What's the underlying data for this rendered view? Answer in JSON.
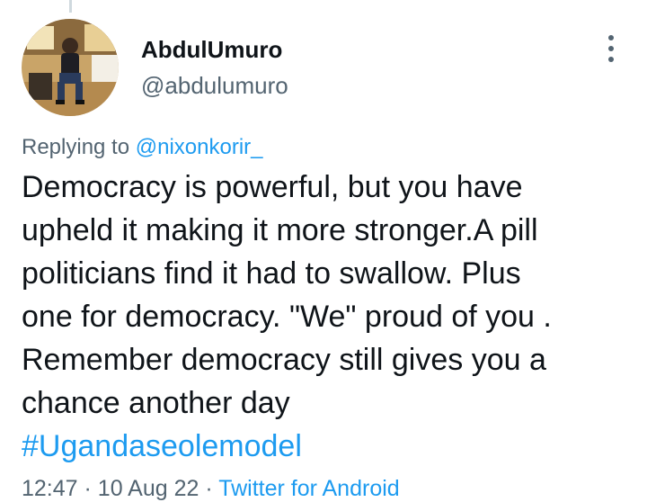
{
  "tweet": {
    "author": {
      "display_name": "AbdulUmuro",
      "handle": "@abdulumuro"
    },
    "replying_prefix": "Replying to",
    "replying_to": "@nixonkorir_",
    "text_lines": [
      "Democracy is powerful, but you have",
      "upheld it making it more stronger.A pill",
      "politicians find it had to swallow. Plus",
      "one for democracy. \"We\" proud of you .",
      "Remember democracy still gives you a",
      "chance another day"
    ],
    "hashtag": "#Ugandaseolemodel",
    "time": "12:47",
    "separator": "·",
    "date": "10 Aug 22",
    "source": "Twitter for Android"
  },
  "icons": {
    "more": "more-vertical-icon"
  },
  "colors": {
    "link": "#1d9bf0",
    "secondary_text": "#536471",
    "primary_text": "#0f1419"
  }
}
